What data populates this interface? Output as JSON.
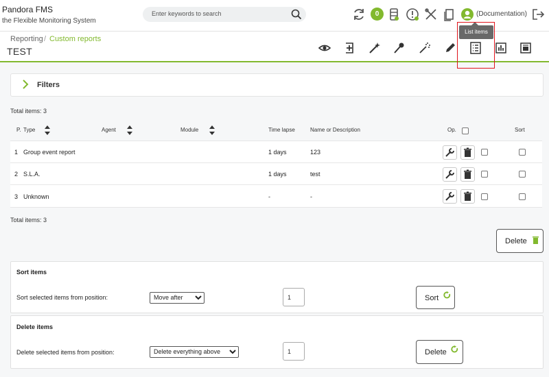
{
  "header": {
    "brand_title": "Pandora FMS",
    "brand_subtitle": "the Flexible Monitoring System",
    "search_placeholder": "Enter keywords to search",
    "notification_count": "0",
    "user_label": "(Documentation)"
  },
  "subheader": {
    "breadcrumb_root": "Reporting",
    "breadcrumb_sep": "/",
    "breadcrumb_current": "Custom reports",
    "title": "TEST",
    "tooltip": "List items",
    "toolbar_icons": [
      "eye-icon",
      "add-item-icon",
      "wand-icon",
      "pin-icon",
      "magic-wand-icon",
      "pencil-icon",
      "list-items-icon",
      "graph-icon",
      "report-icon"
    ]
  },
  "filters": {
    "label": "Filters"
  },
  "totals": {
    "top": "Total items: 3",
    "bottom": "Total items: 3"
  },
  "table": {
    "headers": {
      "position": "P.",
      "type": "Type",
      "agent": "Agent",
      "module": "Module",
      "time_lapse": "Time lapse",
      "name": "Name or Description",
      "op": "Op.",
      "sort": "Sort"
    },
    "rows": [
      {
        "pos": "1",
        "type": "Group event report",
        "agent": "",
        "module": "",
        "time_lapse": "1 days",
        "name": "123"
      },
      {
        "pos": "2",
        "type": "S.L.A.",
        "agent": "",
        "module": "",
        "time_lapse": "1 days",
        "name": "test"
      },
      {
        "pos": "3",
        "type": "Unknown",
        "agent": "",
        "module": "",
        "time_lapse": "-",
        "name": "-"
      }
    ]
  },
  "actions": {
    "delete_label": "Delete"
  },
  "sort_panel": {
    "title": "Sort items",
    "label": "Sort selected items from position:",
    "select_value": "Move after",
    "position_value": "1",
    "button_label": "Sort"
  },
  "delete_panel": {
    "title": "Delete items",
    "label": "Delete selected items from position:",
    "select_value": "Delete everything above",
    "position_value": "1",
    "button_label": "Delete"
  },
  "colors": {
    "accent": "#82b92e",
    "highlight": "#e0121a"
  }
}
